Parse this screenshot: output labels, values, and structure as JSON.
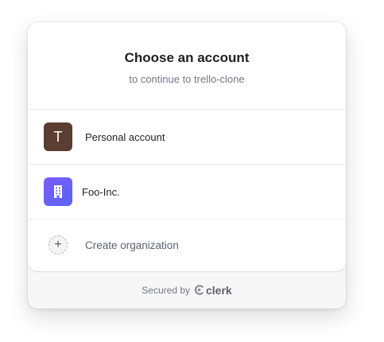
{
  "header": {
    "title": "Choose an account",
    "subtitle": "to continue to trello-clone"
  },
  "accounts": [
    {
      "initial": "T",
      "label": "Personal account",
      "avatar_color": "#5b3d32"
    },
    {
      "label": "Foo-Inc.",
      "avatar_color": "#6c5ff8"
    }
  ],
  "create_org": {
    "icon": "+",
    "label": "Create organization"
  },
  "footer": {
    "secured_by": "Secured by",
    "brand": "clerk"
  },
  "colors": {
    "muted": "#747686",
    "border": "#ececec"
  }
}
